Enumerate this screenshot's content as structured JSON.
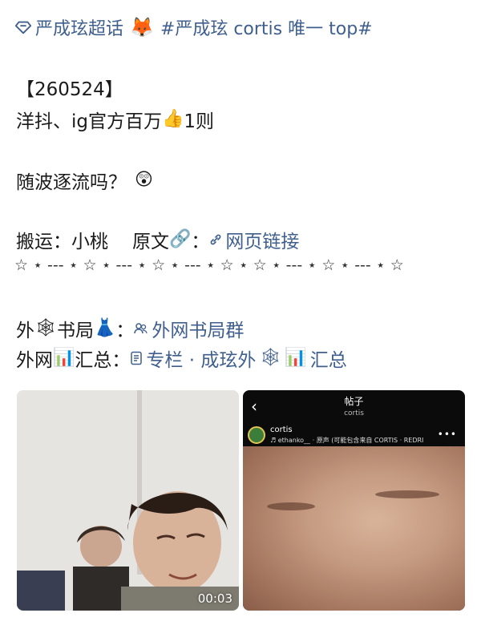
{
  "topic": {
    "supertopic": "严成玹超话",
    "fox_emoji": "🦊",
    "hashtag": "#严成玹 cortis 唯一 top#"
  },
  "post": {
    "date": "【260524】",
    "line1_text": "洋抖、ig官方百万",
    "line1_emoji": "👍",
    "line1_tail": "1则",
    "line2_text": "随波逐流吗？",
    "line2_emoji": "😲",
    "credit_label": "搬运：小桃",
    "source_label": "原文",
    "source_emoji": "🔗",
    "colon": "：",
    "webpage_link": "网页链接",
    "divider": "☆ ⋆ --- ⋆ ☆ ⋆ --- ⋆ ☆ ⋆ --- ⋆ ☆ ⋆ ☆ ⋆ --- ⋆ ☆ ⋆ --- ⋆ ☆",
    "bookclub_label_a": "外",
    "bookclub_label_b": "书局",
    "bookclub_link": "外网书局群",
    "summary_label_a": "外网",
    "summary_label_b": "汇总：",
    "summary_link": "专栏 · 成玹外",
    "summary_link_tail": "汇总",
    "web_emoji": "🕸",
    "dress_emoji": "👗",
    "chart_emoji": "📊"
  },
  "media": {
    "left_duration": "00:03",
    "right_title": "帖子",
    "right_subtitle": "cortis",
    "right_author": "cortis",
    "right_audio": "♬ ethanko__ · 原声 (可能包含来自 CORTIS · REDRI"
  },
  "colors": {
    "link": "#3f5f8e"
  }
}
